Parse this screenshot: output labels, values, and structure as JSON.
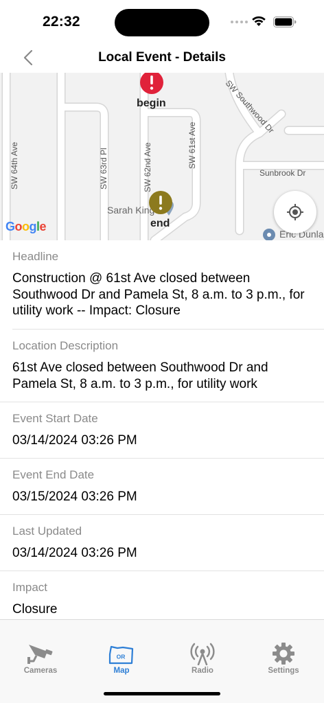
{
  "status_bar": {
    "time": "22:32"
  },
  "nav": {
    "title": "Local Event - Details",
    "back_icon": "chevron-left-icon"
  },
  "map": {
    "streets": [
      "SW 64th Ave",
      "SW 63rd Pl",
      "SW 62nd Ave",
      "SW 61st Ave",
      "SW Southwood Dr",
      "Sunbrook Dr"
    ],
    "markers": {
      "begin": "begin",
      "end": "end"
    },
    "pois": [
      "Sarah King",
      "Eric Dunla"
    ],
    "logo": "Google",
    "colors": {
      "begin_marker": "#e0223a",
      "end_marker": "#8c7a1e"
    }
  },
  "details": [
    {
      "label": "Headline",
      "value": "Construction @ 61st Ave closed between Southwood Dr and Pamela St, 8 a.m. to 3 p.m., for utility work -- Impact: Closure"
    },
    {
      "label": "Location Description",
      "value": "61st Ave closed between Southwood Dr and Pamela St, 8 a.m. to 3 p.m., for utility work"
    },
    {
      "label": "Event Start Date",
      "value": "03/14/2024 03:26 PM"
    },
    {
      "label": "Event End Date",
      "value": "03/15/2024 03:26 PM"
    },
    {
      "label": "Last Updated",
      "value": "03/14/2024 03:26 PM"
    },
    {
      "label": "Impact",
      "value": "Closure"
    }
  ],
  "tabs": [
    {
      "label": "Cameras",
      "icon": "camera-icon",
      "active": false
    },
    {
      "label": "Map",
      "icon": "oregon-map-icon",
      "badge": "OR",
      "active": true
    },
    {
      "label": "Radio",
      "icon": "radio-icon",
      "active": false
    },
    {
      "label": "Settings",
      "icon": "gear-icon",
      "active": false
    }
  ],
  "colors": {
    "accent": "#2e7fd6",
    "tab_inactive": "#8c8c8c"
  }
}
